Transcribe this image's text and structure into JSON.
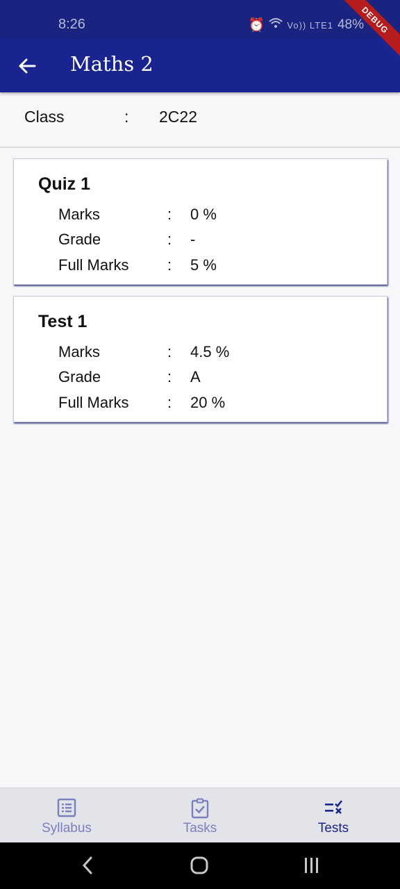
{
  "status_bar": {
    "time": "8:26",
    "signal_text": "Vo)) LTE1",
    "battery": "48%"
  },
  "debug_banner": "DEBUG",
  "app_bar": {
    "title": "Maths 2",
    "back_icon": "arrow-left-icon"
  },
  "class_info": {
    "label": "Class",
    "separator": ":",
    "value": "2C22"
  },
  "cards": [
    {
      "title": "Quiz 1",
      "rows": [
        {
          "label": "Marks",
          "separator": ":",
          "value": "0 %"
        },
        {
          "label": "Grade",
          "separator": ":",
          "value": "-"
        },
        {
          "label": "Full Marks",
          "separator": ":",
          "value": "5 %"
        }
      ]
    },
    {
      "title": "Test 1",
      "rows": [
        {
          "label": "Marks",
          "separator": ":",
          "value": "4.5 %"
        },
        {
          "label": "Grade",
          "separator": ":",
          "value": "A"
        },
        {
          "label": "Full Marks",
          "separator": ":",
          "value": "20 %"
        }
      ]
    }
  ],
  "bottom_nav": {
    "items": [
      {
        "label": "Syllabus",
        "icon": "list-alt-icon",
        "active": false
      },
      {
        "label": "Tasks",
        "icon": "clipboard-check-icon",
        "active": false
      },
      {
        "label": "Tests",
        "icon": "checklist-icon",
        "active": true
      }
    ]
  },
  "colors": {
    "primary": "#1a2490",
    "status_bar": "#1a2380",
    "nav_inactive": "#7a7fbf",
    "debug": "#b71c1c"
  }
}
